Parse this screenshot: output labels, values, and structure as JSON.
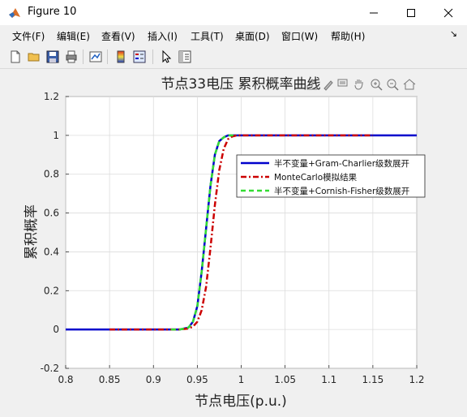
{
  "window": {
    "title": "Figure 10",
    "buttons": {
      "minimize": "minimize-icon",
      "maximize": "maximize-icon",
      "close": "close-icon"
    }
  },
  "menu": {
    "items": [
      "文件(F)",
      "编辑(E)",
      "查看(V)",
      "插入(I)",
      "工具(T)",
      "桌面(D)",
      "窗口(W)",
      "帮助(H)"
    ],
    "overflow_icon": "chevron-icon"
  },
  "toolbar": {
    "icons": [
      "new-figure-icon",
      "open-file-icon",
      "save-icon",
      "print-icon",
      "link-plot-icon",
      "colorbar-icon",
      "legend-icon",
      "pointer-icon",
      "property-editor-icon"
    ]
  },
  "axes_toolbar": {
    "icons": [
      "export-icon",
      "brush-icon",
      "datatip-icon",
      "pan-icon",
      "zoom-in-icon",
      "zoom-out-icon",
      "home-icon"
    ]
  },
  "colors": {
    "series1": "#0000cc",
    "series2": "#cc0000",
    "series3": "#33dd33",
    "grid": "#dcdcdc",
    "axes_bg": "#ffffff"
  },
  "chart_data": {
    "type": "line",
    "title": "节点33电压 累积概率曲线",
    "xlabel": "节点电压(p.u.)",
    "ylabel": "累积概率",
    "xlim": [
      0.8,
      1.2
    ],
    "ylim": [
      -0.2,
      1.2
    ],
    "xticks": [
      0.8,
      0.85,
      0.9,
      0.95,
      1.0,
      1.05,
      1.1,
      1.15,
      1.2
    ],
    "xtick_labels": [
      "0.8",
      "0.85",
      "0.9",
      "0.95",
      "1",
      "1.05",
      "1.1",
      "1.15",
      "1.2"
    ],
    "yticks": [
      -0.2,
      0,
      0.2,
      0.4,
      0.6,
      0.8,
      1.0,
      1.2
    ],
    "ytick_labels": [
      "-0.2",
      "0",
      "0.2",
      "0.4",
      "0.6",
      "0.8",
      "1",
      "1.2"
    ],
    "grid": true,
    "legend_position": "right",
    "series": [
      {
        "name": "半不变量+Gram-Charlier级数展开",
        "style": "solid",
        "color": "#0000cc",
        "x": [
          0.8,
          0.85,
          0.9,
          0.93,
          0.94,
          0.945,
          0.95,
          0.955,
          0.96,
          0.965,
          0.97,
          0.975,
          0.98,
          0.985,
          0.99,
          1.0,
          1.05,
          1.1,
          1.15,
          1.2
        ],
        "y": [
          0,
          0,
          0,
          0,
          0.01,
          0.04,
          0.12,
          0.3,
          0.52,
          0.74,
          0.9,
          0.97,
          0.99,
          1.0,
          1.0,
          1.0,
          1.0,
          1.0,
          1.0,
          1.0
        ]
      },
      {
        "name": "MonteCarlo模拟结果",
        "style": "dashdot",
        "color": "#cc0000",
        "x": [
          0.85,
          0.9,
          0.93,
          0.94,
          0.945,
          0.95,
          0.955,
          0.96,
          0.965,
          0.97,
          0.975,
          0.98,
          0.985,
          0.99,
          0.995,
          1.0,
          1.05,
          1.1,
          1.15
        ],
        "y": [
          0,
          0,
          0,
          0.005,
          0.015,
          0.04,
          0.1,
          0.22,
          0.42,
          0.64,
          0.82,
          0.93,
          0.98,
          0.995,
          1.0,
          1.0,
          1.0,
          1.0,
          1.0
        ]
      },
      {
        "name": "半不变量+Cornish-Fisher级数展开",
        "style": "dashed",
        "color": "#33dd33",
        "x": [
          0.92,
          0.93,
          0.94,
          0.945,
          0.95,
          0.955,
          0.96,
          0.965,
          0.97,
          0.975,
          0.98,
          0.985,
          0.99,
          0.995
        ],
        "y": [
          0,
          0,
          0.01,
          0.04,
          0.12,
          0.3,
          0.52,
          0.74,
          0.9,
          0.97,
          0.99,
          1.0,
          1.0,
          1.0
        ]
      }
    ]
  }
}
